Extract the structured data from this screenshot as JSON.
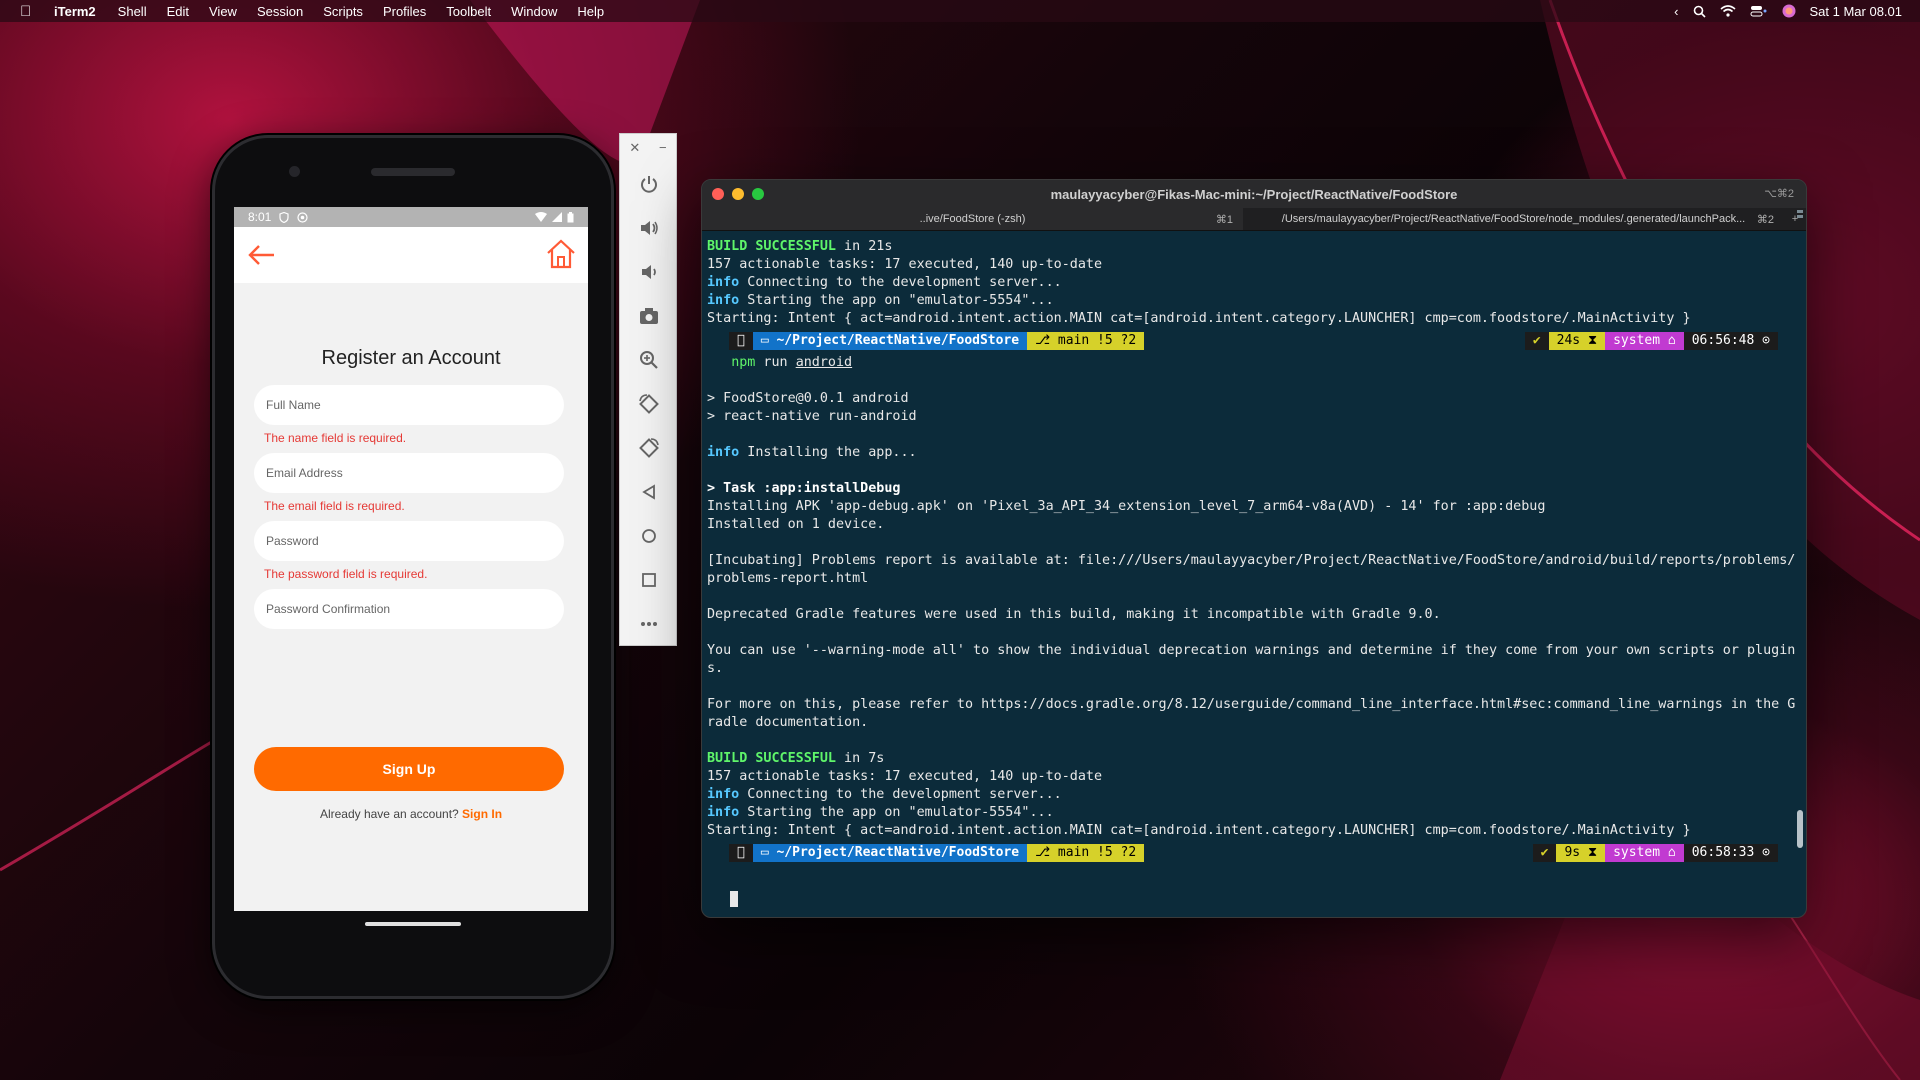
{
  "menubar": {
    "app_name": "iTerm2",
    "items": [
      "Shell",
      "Edit",
      "View",
      "Session",
      "Scripts",
      "Profiles",
      "Toolbelt",
      "Window",
      "Help"
    ],
    "datetime": "Sat 1 Mar  08.01"
  },
  "phone": {
    "status_time": "8:01",
    "title": "Register an Account",
    "fields": [
      {
        "placeholder": "Full Name",
        "error": "The name field is required."
      },
      {
        "placeholder": "Email Address",
        "error": "The email field is required."
      },
      {
        "placeholder": "Password",
        "error": "The password field is required."
      },
      {
        "placeholder": "Password Confirmation",
        "error": ""
      }
    ],
    "signup_label": "Sign Up",
    "have_account": "Already have an account?",
    "signin_link": "Sign In",
    "accent_color": "#ff6a00",
    "error_color": "#e53935"
  },
  "emulator_toolbar": {
    "close": "✕",
    "minimize": "−",
    "buttons": [
      "power-icon",
      "volume-up-icon",
      "volume-down-icon",
      "camera-icon",
      "zoom-icon",
      "rotate-left-icon",
      "rotate-right-icon",
      "back-icon",
      "home-icon",
      "overview-icon",
      "more-icon"
    ]
  },
  "terminal": {
    "title": "maulayyacyber@Fikas-Mac-mini:~/Project/ReactNative/FoodStore",
    "title_shortcut": "⌥⌘2",
    "tabs": [
      {
        "label": "..ive/FoodStore (-zsh)",
        "shortcut": "⌘1"
      },
      {
        "label": "/Users/maulayyacyber/Project/ReactNative/FoodStore/node_modules/.generated/launchPack...",
        "shortcut": "⌘2"
      }
    ],
    "block1": {
      "build_successful": "BUILD SUCCESSFUL",
      "build_time": " in 21s",
      "tasks": "157 actionable tasks: 17 executed, 140 up-to-date",
      "info1": "info",
      "connecting": " Connecting to the development server...",
      "info2": "info",
      "starting": " Starting the app on \"emulator-5554\"...",
      "intent": "Starting: Intent { act=android.intent.action.MAIN cat=[android.intent.category.LAUNCHER] cmp=com.foodstore/.MainActivity }"
    },
    "prompt1": {
      "path": " ~/Project/ReactNative/FoodStore",
      "git": " main !5 ?2",
      "ok": "✔",
      "duration": "24s ⧗",
      "system": "system ⌂",
      "time": "06:56:48 ⊙",
      "command_npm": "npm",
      "command_run": " run ",
      "command_arg": "android"
    },
    "block2": {
      "pkg": "> FoodStore@0.0.1 android",
      "script": "> react-native run-android",
      "info": "info",
      "installing": " Installing the app...",
      "task": "> Task :app:installDebug",
      "apk": "Installing APK 'app-debug.apk' on 'Pixel_3a_API_34_extension_level_7_arm64-v8a(AVD) - 14' for :app:debug",
      "installed": "Installed on 1 device.",
      "incubating": "[Incubating] Problems report is available at: file:///Users/maulayyacyber/Project/ReactNative/FoodStore/android/build/reports/problems/",
      "incubating2": "problems-report.html",
      "deprecated": "Deprecated Gradle features were used in this build, making it incompatible with Gradle 9.0.",
      "warning_mode": "You can use '--warning-mode all' to show the individual deprecation warnings and determine if they come from your own scripts or plugin",
      "warning_mode2": "s.",
      "more_info": "For more on this, please refer to https://docs.gradle.org/8.12/userguide/command_line_interface.html#sec:command_line_warnings in the G",
      "more_info2": "radle documentation."
    },
    "block3": {
      "build_successful": "BUILD SUCCESSFUL",
      "build_time": " in 7s",
      "tasks": "157 actionable tasks: 17 executed, 140 up-to-date",
      "info1": "info",
      "connecting": " Connecting to the development server...",
      "info2": "info",
      "starting": " Starting the app on \"emulator-5554\"...",
      "intent": "Starting: Intent { act=android.intent.action.MAIN cat=[android.intent.category.LAUNCHER] cmp=com.foodstore/.MainActivity }"
    },
    "prompt2": {
      "path": " ~/Project/ReactNative/FoodStore",
      "git": " main !5 ?2",
      "ok": "✔",
      "duration": "9s ⧗",
      "system": "system ⌂",
      "time": "06:58:33 ⊙"
    }
  }
}
